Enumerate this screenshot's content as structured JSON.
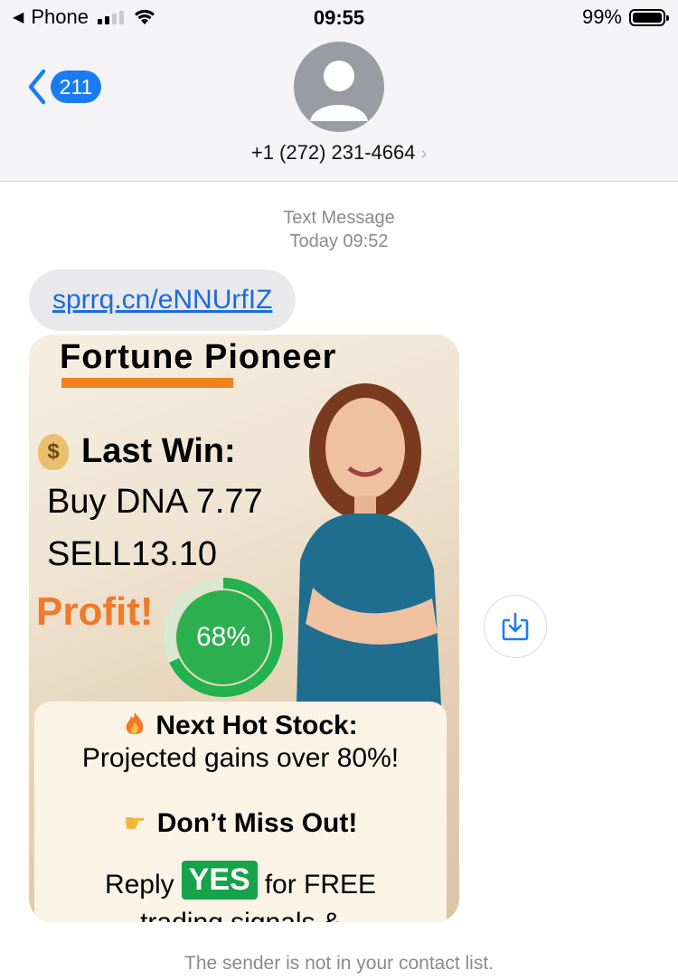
{
  "status_bar": {
    "back_app": "Phone",
    "time": "09:55",
    "battery": "99%"
  },
  "header": {
    "back_count": "211",
    "contact": "+1 (272) 231-4664",
    "contact_chevron": "›"
  },
  "thread": {
    "type_label": "Text Message",
    "timestamp": "Today 09:52",
    "link_text": "sprrq.cn/eNNUrfIZ"
  },
  "image_ad": {
    "title": "Fortune Pioneer",
    "money_icon": "$",
    "last_win": "Last Win:",
    "buy_line": "Buy DNA 7.77",
    "sell_line": "SELL13.10",
    "profit": "Profit!",
    "ring_percent": "68%",
    "ring_fraction": 0.68,
    "next_hot": "Next Hot Stock:",
    "projected": "Projected gains over 80%!",
    "dont_miss": "Don’t Miss Out!",
    "reply_prefix": "Reply",
    "yes": "YES",
    "reply_suffix": "for FREE",
    "trading_partial": "trading signals &"
  },
  "footer": {
    "note": "The sender is not in your contact list."
  },
  "colors": {
    "accent_blue": "#1a7cf4",
    "link_blue": "#1a6ae0",
    "profit_orange": "#f07a2a",
    "ring_green": "#22b14c",
    "yes_green": "#16a34a"
  }
}
